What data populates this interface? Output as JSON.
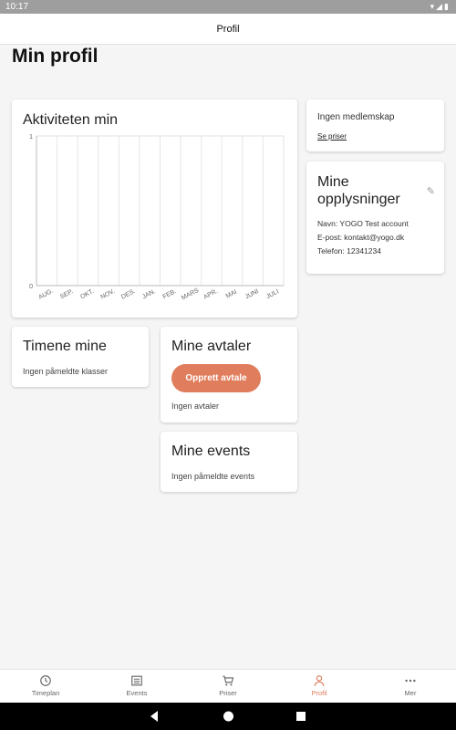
{
  "status": {
    "time": "10:17",
    "icons": "▾◢▮"
  },
  "app": {
    "title": "Profil"
  },
  "page": {
    "title": "Min profil"
  },
  "activity": {
    "title": "Aktiviteten min"
  },
  "chart_data": {
    "type": "line",
    "title": "Aktiviteten min",
    "categories": [
      "AUG.",
      "SEP.",
      "OKT.",
      "NOV.",
      "DES.",
      "JAN.",
      "FEB.",
      "MARS",
      "APR.",
      "MAI",
      "JUNI",
      "JULI"
    ],
    "series": [
      {
        "values": [
          0,
          0,
          0,
          0,
          0,
          0,
          0,
          0,
          0,
          0,
          0,
          0
        ]
      }
    ],
    "ylim": [
      0,
      1
    ],
    "yticks": [
      "0",
      "1"
    ],
    "grid": true
  },
  "membership": {
    "label": "Ingen medlemskap",
    "link": "Se priser"
  },
  "info": {
    "title": "Mine opplysninger",
    "name": "Navn: YOGO Test account",
    "email": "E-post: kontakt@yogo.dk",
    "phone": "Telefon: 12341234"
  },
  "classes": {
    "title": "Timene mine",
    "empty": "Ingen påmeldte klasser"
  },
  "appointments": {
    "title": "Mine avtaler",
    "button": "Opprett avtale",
    "empty": "Ingen avtaler"
  },
  "events": {
    "title": "Mine events",
    "empty": "Ingen påmeldte events"
  },
  "nav": {
    "items": [
      {
        "label": "Timeplan",
        "icon": "clock-icon"
      },
      {
        "label": "Events",
        "icon": "list-icon"
      },
      {
        "label": "Priser",
        "icon": "cart-icon"
      },
      {
        "label": "Profil",
        "icon": "person-icon"
      },
      {
        "label": "Mer",
        "icon": "more-icon"
      }
    ],
    "active_color": "#e07d5c"
  },
  "colors": {
    "accent": "#e07d5c"
  }
}
